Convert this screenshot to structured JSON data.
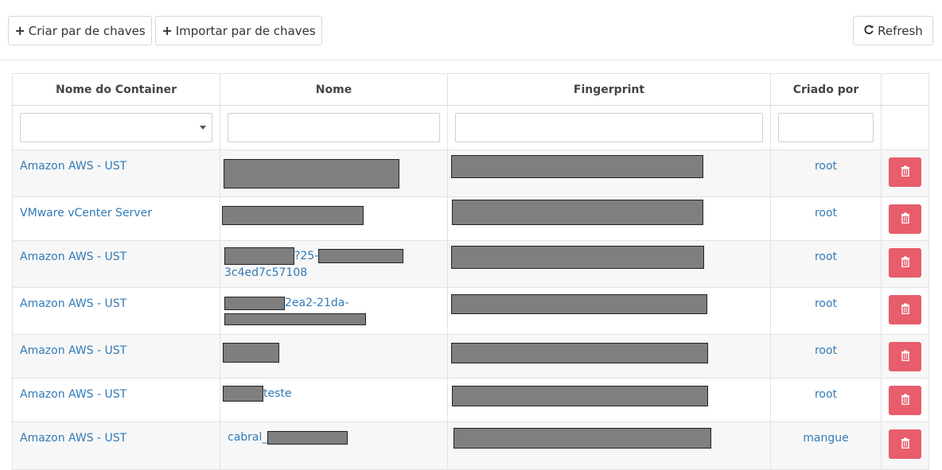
{
  "toolbar": {
    "create_label": "Criar par de chaves",
    "import_label": "Importar par de chaves",
    "refresh_label": "Refresh"
  },
  "table": {
    "headers": {
      "container": "Nome do Container",
      "name": "Nome",
      "fingerprint": "Fingerprint",
      "created_by": "Criado por"
    },
    "filters": {
      "container_value": "",
      "name_value": "",
      "fingerprint_value": "",
      "created_by_value": ""
    },
    "rows": [
      {
        "container": "Amazon AWS - UST",
        "name_line1_tail": "",
        "name_line2": "",
        "created_by": "root"
      },
      {
        "container": "VMware vCenter Server",
        "name_line1_tail": "",
        "name_line2": "",
        "created_by": "root"
      },
      {
        "container": "Amazon AWS - UST",
        "name_line1_tail": "?25-",
        "name_line2": "3c4ed7c57108",
        "created_by": "root"
      },
      {
        "container": "Amazon AWS - UST",
        "name_line1_tail": "2ea2-21da-",
        "name_line2": "",
        "created_by": "root"
      },
      {
        "container": "Amazon AWS - UST",
        "name_line1_tail": "",
        "name_line2": "",
        "created_by": "root"
      },
      {
        "container": "Amazon AWS - UST",
        "name_line1_tail": "teste",
        "name_line2": "",
        "created_by": "root"
      },
      {
        "container": "Amazon AWS - UST",
        "name_line1_head": "cabral_",
        "name_line2": "",
        "created_by": "mangue"
      }
    ]
  },
  "colors": {
    "link": "#337ab7",
    "danger": "#e85d6b",
    "redaction": "#7f7f7f"
  },
  "icons": {
    "create": "plus-icon",
    "import": "plus-icon",
    "refresh": "refresh-icon",
    "delete": "trash-icon"
  }
}
